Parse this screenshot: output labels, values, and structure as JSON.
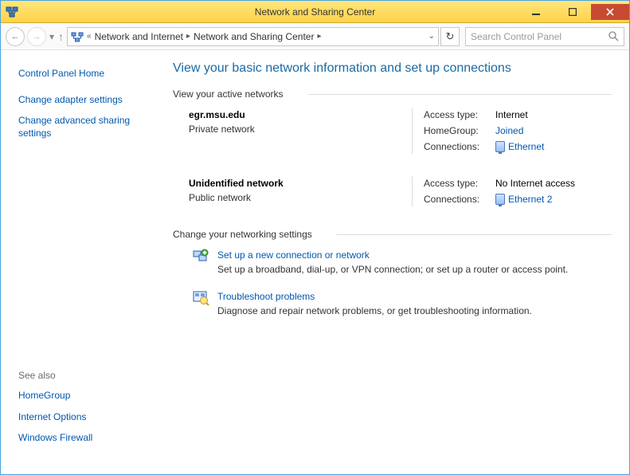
{
  "window": {
    "title": "Network and Sharing Center"
  },
  "nav": {
    "breadcrumb_prefix": "«",
    "crumb1": "Network and Internet",
    "crumb2": "Network and Sharing Center"
  },
  "search": {
    "placeholder": "Search Control Panel"
  },
  "sidebar": {
    "home": "Control Panel Home",
    "adapter": "Change adapter settings",
    "advanced": "Change advanced sharing settings",
    "see_also_label": "See also",
    "homegroup": "HomeGroup",
    "internet_options": "Internet Options",
    "firewall": "Windows Firewall"
  },
  "content": {
    "title": "View your basic network information and set up connections",
    "active_header": "View your active networks",
    "labels": {
      "access_type": "Access type:",
      "homegroup": "HomeGroup:",
      "connections": "Connections:"
    },
    "net1": {
      "name": "egr.msu.edu",
      "type": "Private network",
      "access": "Internet",
      "homegroup": "Joined",
      "conn": "Ethernet"
    },
    "net2": {
      "name": "Unidentified network",
      "type": "Public network",
      "access": "No Internet access",
      "conn": "Ethernet 2"
    },
    "change_header": "Change your networking settings",
    "setup": {
      "title": "Set up a new connection or network",
      "desc": "Set up a broadband, dial-up, or VPN connection; or set up a router or access point."
    },
    "troubleshoot": {
      "title": "Troubleshoot problems",
      "desc": "Diagnose and repair network problems, or get troubleshooting information."
    }
  }
}
